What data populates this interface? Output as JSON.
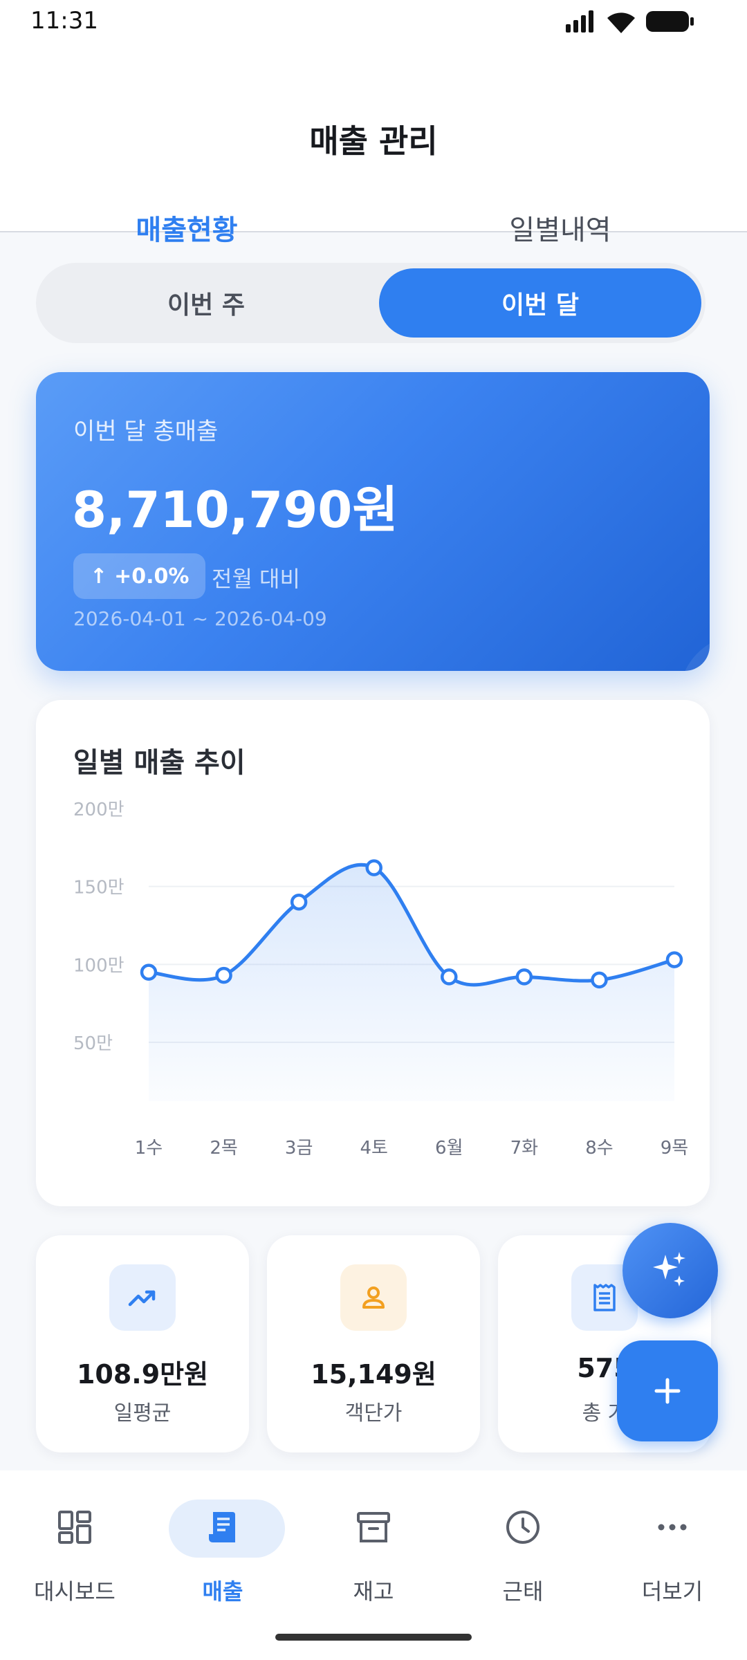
{
  "status_bar": {
    "time": "11:31"
  },
  "header": {
    "title": "매출 관리"
  },
  "tabs": [
    {
      "label": "매출현황",
      "active": true
    },
    {
      "label": "일별내역",
      "active": false
    }
  ],
  "period_toggle": {
    "week": "이번 주",
    "month": "이번 달",
    "selected": "month"
  },
  "summary": {
    "label": "이번 달 총매출",
    "amount": "8,710,790원",
    "change": "+0.0%",
    "change_arrow": "↑",
    "compare_label": "전월 대비",
    "date_range": "2026-04-01 ~ 2026-04-09"
  },
  "chart": {
    "title": "일별 매출 추이"
  },
  "chart_data": {
    "type": "area",
    "title": "일별 매출 추이",
    "categories": [
      "1수",
      "2목",
      "3금",
      "4토",
      "6월",
      "7화",
      "8수",
      "9목"
    ],
    "values": [
      95,
      93,
      140,
      162,
      92,
      92,
      90,
      103
    ],
    "y_ticks": [
      "200만",
      "150만",
      "100만",
      "50만"
    ],
    "y_tick_values": [
      200,
      150,
      100,
      50
    ],
    "ylim": [
      0,
      200
    ],
    "unit": "만",
    "color": "#2f7ff0",
    "grid": true
  },
  "stats": [
    {
      "value": "108.9만원",
      "label": "일평균",
      "icon": "trending-up-icon",
      "color": "#2f7ff0",
      "bg": "#e6effd"
    },
    {
      "value": "15,149원",
      "label": "객단가",
      "icon": "person-icon",
      "color": "#f2a020",
      "bg": "#fdf2e1"
    },
    {
      "value": "575",
      "label": "총 거",
      "icon": "receipt-icon",
      "color": "#2f7ff0",
      "bg": "#e6effd"
    }
  ],
  "fabs": {
    "ai": "sparkle-icon",
    "add": "plus-icon"
  },
  "nav": [
    {
      "label": "대시보드",
      "icon": "dashboard-icon",
      "active": false
    },
    {
      "label": "매출",
      "icon": "receipt-icon",
      "active": true
    },
    {
      "label": "재고",
      "icon": "archive-icon",
      "active": false
    },
    {
      "label": "근태",
      "icon": "clock-icon",
      "active": false
    },
    {
      "label": "더보기",
      "icon": "more-icon",
      "active": false
    }
  ]
}
